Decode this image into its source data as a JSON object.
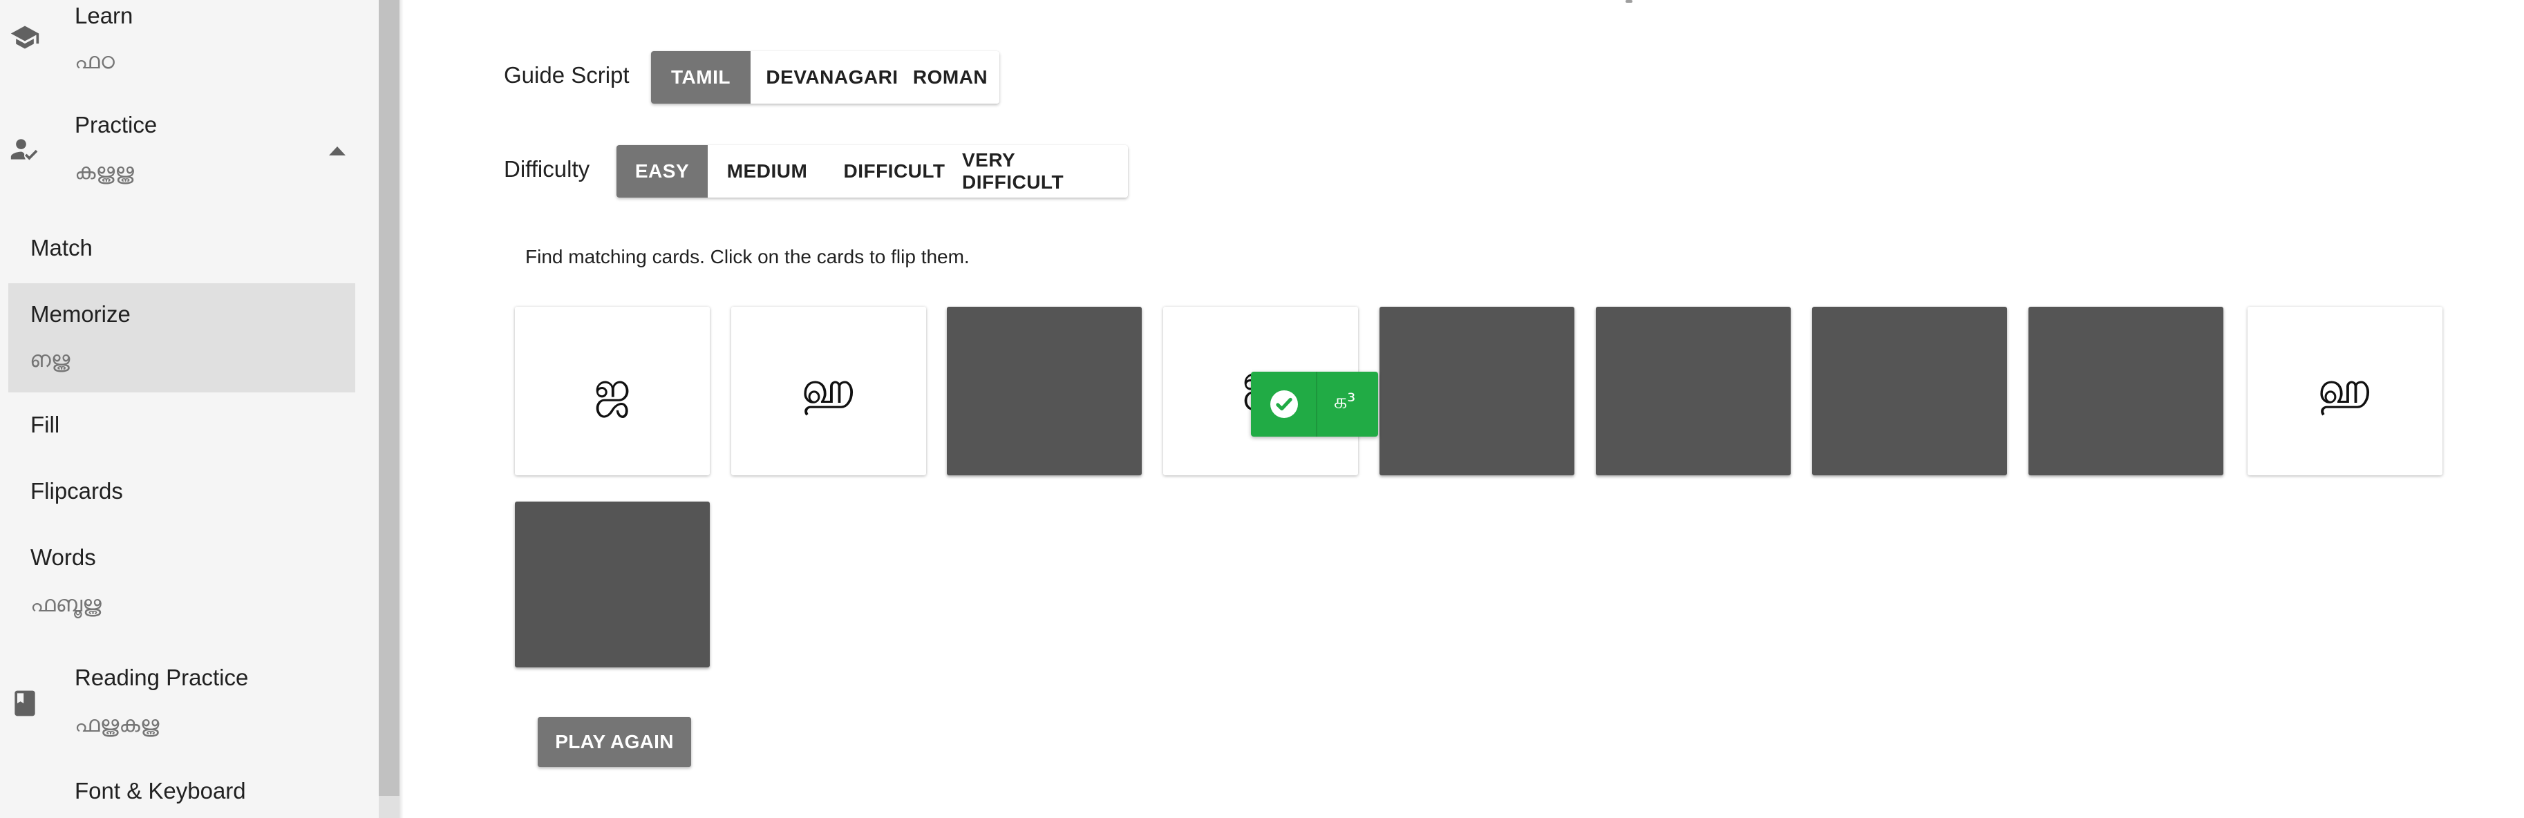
{
  "sidebar": {
    "learn": {
      "title": "Learn",
      "subtitle": "ഫഠ",
      "icon": "graduation-cap-icon"
    },
    "practice": {
      "title": "Practice",
      "subtitle": "കൠൠ",
      "icon": "person-check-icon"
    },
    "practice_items": [
      {
        "title": "Match",
        "subtitle": ""
      },
      {
        "title": "Memorize",
        "subtitle": "ഩൠ"
      },
      {
        "title": "Fill",
        "subtitle": ""
      },
      {
        "title": "Flipcards",
        "subtitle": ""
      },
      {
        "title": "Words",
        "subtitle": "ഫബൂൠ"
      }
    ],
    "reading": {
      "title": "Reading Practice",
      "subtitle": "ഫൠകൠ",
      "icon": "book-icon"
    },
    "font_keyboard": {
      "title": "Font & Keyboard"
    }
  },
  "guide_script": {
    "label": "Guide Script",
    "options": [
      "TAMIL",
      "DEVANAGARI",
      "ROMAN"
    ],
    "selected": "TAMIL"
  },
  "difficulty": {
    "label": "Difficulty",
    "options": [
      "EASY",
      "MEDIUM",
      "DIFFICULT",
      "VERY DIFFICULT"
    ],
    "selected": "EASY"
  },
  "game": {
    "instructions": "Find matching cards. Click on the cards to flip them.",
    "cards": [
      {
        "face": "up",
        "symbol": "ஜ"
      },
      {
        "face": "up",
        "symbol": "ஹ"
      },
      {
        "face": "down",
        "symbol": ""
      },
      {
        "face": "up",
        "symbol": "ஜ"
      },
      {
        "face": "down",
        "symbol": ""
      },
      {
        "face": "down",
        "symbol": ""
      },
      {
        "face": "down",
        "symbol": ""
      },
      {
        "face": "down",
        "symbol": ""
      },
      {
        "face": "up",
        "symbol": "ஹ"
      },
      {
        "face": "down",
        "symbol": ""
      }
    ],
    "toast": {
      "text": "க³",
      "icon": "check-circle-icon",
      "color": "#21ab45"
    },
    "play_again": "PLAY AGAIN"
  },
  "colors": {
    "selected": "#757575",
    "card_back": "#555555",
    "sidebar_bg": "#f5f5f5",
    "active_item": "#e0e0e0"
  }
}
